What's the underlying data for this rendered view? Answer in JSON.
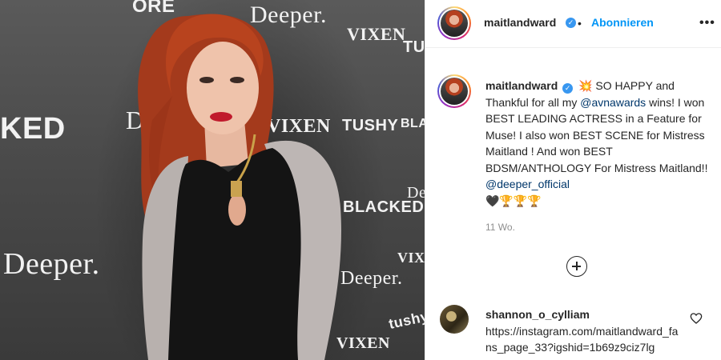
{
  "photo": {
    "backdrop_texts": {
      "t1": "ORE",
      "t2": "Deeper.",
      "t3": "VIXEN",
      "t4": "TUS",
      "t5": "KED",
      "t6": "D",
      "t7": "VIXEN",
      "t8": "TUSHY",
      "t9": "BLAC",
      "t10": "BLACKED",
      "t11": "De",
      "t12": "Deeper.",
      "t13": "VIXEN",
      "t14": "Deeper.",
      "t15": "tushy",
      "t16": "VIXEN"
    }
  },
  "header": {
    "username": "maitlandward",
    "separator": "•",
    "follow_label": "Abonnieren",
    "more_label": "•••"
  },
  "caption": {
    "username": "maitlandward",
    "emoji_star": "💥",
    "text_1": " SO HAPPY and Thankful for all my ",
    "mention_1": "@avnawards",
    "text_2": " wins! I won BEST LEADING ACTRESS in a Feature for Muse! I also won BEST SCENE for Mistress Maitland ! And won BEST BDSM/ANTHOLOGY For Mistress Maitland!! ",
    "mention_2": "@deeper_official",
    "emoji_line": "🖤🏆🏆🏆"
  },
  "timestamp": "11 Wo.",
  "comment": {
    "username": "shannon_o_cylliam",
    "text": "https://instagram.com/maitlandward_fans_page_33?igshid=1b69z9ciz7lg"
  },
  "icons": {
    "verified": "verified-badge-icon",
    "load_more": "plus-circle-icon",
    "like": "heart-outline-icon"
  },
  "colors": {
    "accent": "#0095f6",
    "verified": "#3897f0",
    "mention": "#00376b",
    "muted": "#8e8e8e"
  }
}
